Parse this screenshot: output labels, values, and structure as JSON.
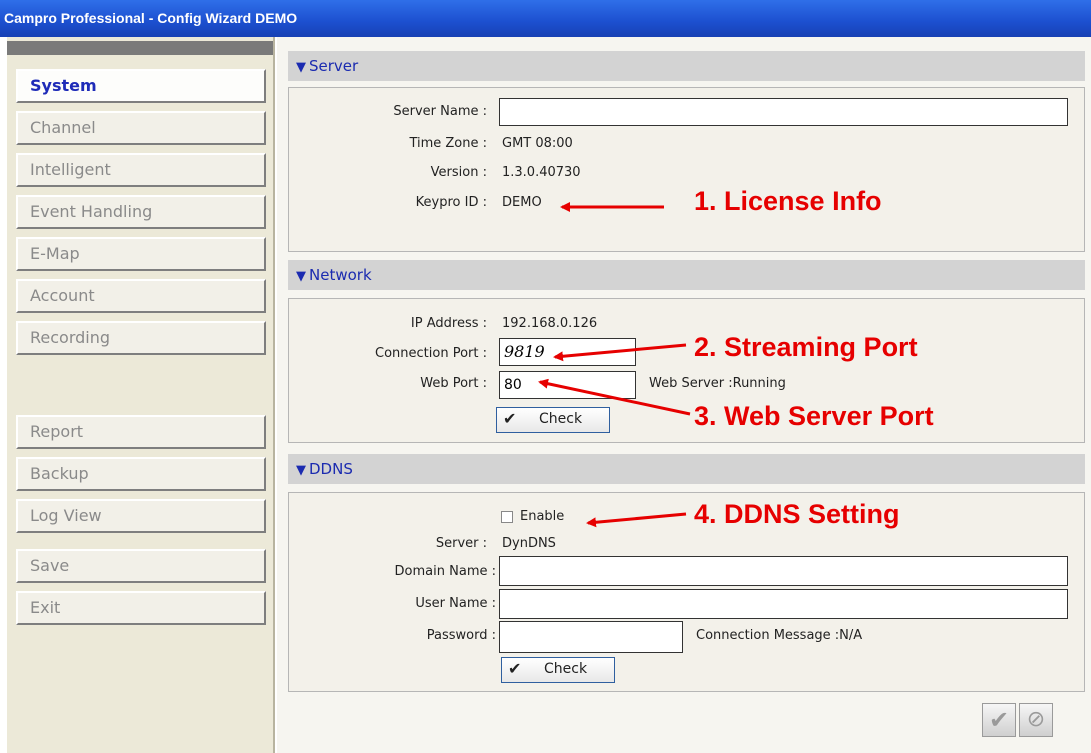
{
  "window": {
    "title": "Campro Professional - Config Wizard DEMO"
  },
  "sidebar": {
    "items": [
      {
        "label": "System",
        "active": true
      },
      {
        "label": "Channel"
      },
      {
        "label": "Intelligent"
      },
      {
        "label": "Event Handling"
      },
      {
        "label": "E-Map"
      },
      {
        "label": "Account"
      },
      {
        "label": "Recording"
      },
      {
        "label": "Report"
      },
      {
        "label": "Backup"
      },
      {
        "label": "Log View"
      },
      {
        "label": "Save"
      },
      {
        "label": "Exit"
      }
    ]
  },
  "server": {
    "header": "Server",
    "server_name_label": "Server Name :",
    "server_name_value": "",
    "time_zone_label": "Time Zone :",
    "time_zone_value": "GMT 08:00",
    "version_label": "Version :",
    "version_value": "1.3.0.40730",
    "keypro_label": "Keypro ID :",
    "keypro_value": "DEMO"
  },
  "network": {
    "header": "Network",
    "ip_label": "IP Address :",
    "ip_value": "192.168.0.126",
    "conn_port_label": "Connection Port :",
    "conn_port_value": "9819",
    "web_port_label": "Web Port :",
    "web_port_value": "80",
    "web_server_status": "Web Server :Running",
    "check_label": "Check"
  },
  "ddns": {
    "header": "DDNS",
    "enable_label": "Enable",
    "enabled": false,
    "server_label": "Server :",
    "server_value": "DynDNS",
    "domain_label": "Domain Name :",
    "domain_value": "",
    "user_label": "User Name :",
    "user_value": "",
    "password_label": "Password :",
    "password_value": "",
    "connection_message": "Connection Message :N/A",
    "check_label": "Check"
  },
  "annotations": {
    "a1": "1. License Info",
    "a2": "2. Streaming Port",
    "a3": "3. Web Server Port",
    "a4": "4. DDNS Setting"
  },
  "colors": {
    "title_bar": "#2a62e0",
    "active_nav": "#1e2bb8",
    "section_text": "#1b2bb0",
    "annotation_red": "#e60000"
  },
  "icons": {
    "section_marker": "section-marker-icon",
    "check_tick": "check-tick-icon",
    "ok_button": "ok-check-icon",
    "cancel_button": "cancel-circle-icon"
  }
}
